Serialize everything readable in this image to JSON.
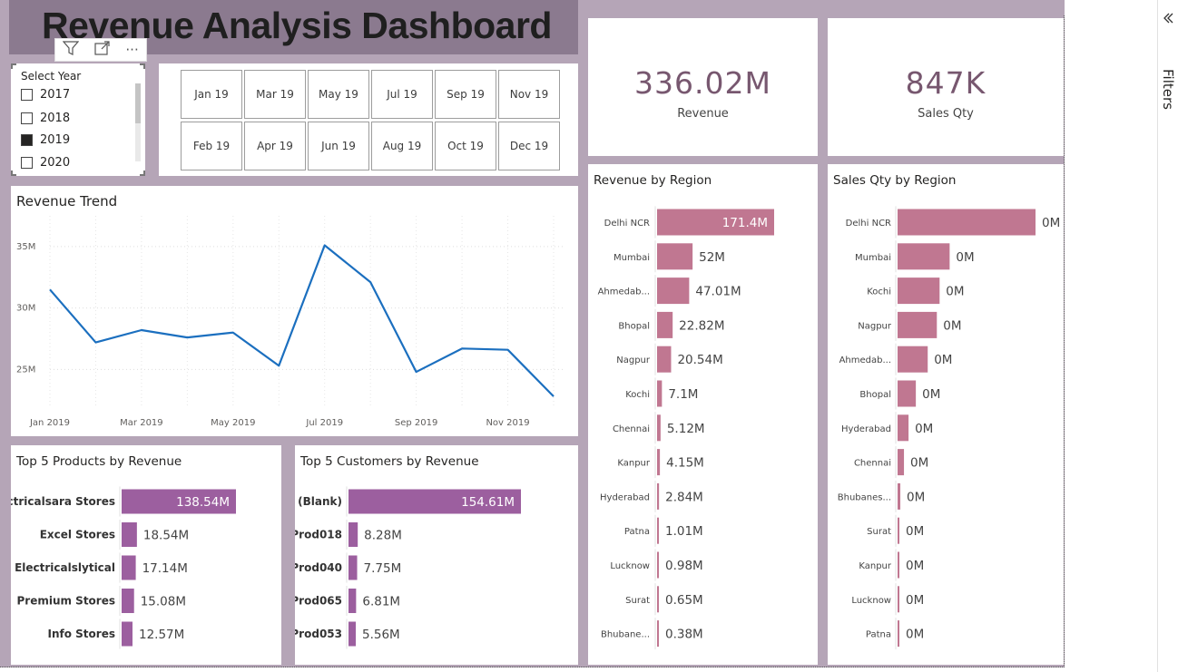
{
  "title": "Revenue Analysis Dashboard",
  "visual_toolbar": {
    "filter_icon": "filter-icon",
    "focus_icon": "focus-mode-icon",
    "more_icon": "more-options-icon",
    "more_label": "···"
  },
  "year_slicer": {
    "header": "Select Year",
    "options": [
      {
        "label": "2017",
        "checked": false
      },
      {
        "label": "2018",
        "checked": false
      },
      {
        "label": "2019",
        "checked": true
      },
      {
        "label": "2020",
        "checked": false
      }
    ]
  },
  "month_slicer": {
    "months": [
      "Jan 19",
      "Mar 19",
      "May 19",
      "Jul 19",
      "Sep 19",
      "Nov 19",
      "Feb 19",
      "Apr 19",
      "Jun 19",
      "Aug 19",
      "Oct 19",
      "Dec 19"
    ]
  },
  "kpis": [
    {
      "value": "336.02M",
      "label": "Revenue"
    },
    {
      "value": "847K",
      "label": "Sales Qty"
    }
  ],
  "filters_pane": {
    "label": "Filters",
    "collapse_icon": "chevron-left-icon"
  },
  "colors": {
    "bar": "#c07791",
    "purple_bar": "#9c5f9f",
    "line": "#1b6fbf",
    "background": "#b5a5b7",
    "title_bg": "#8b7a8f",
    "kpi": "#77576f"
  },
  "chart_data": [
    {
      "type": "line",
      "title": "Revenue Trend",
      "x": [
        "2019-01",
        "2019-02",
        "2019-03",
        "2019-04",
        "2019-05",
        "2019-06",
        "2019-07",
        "2019-08",
        "2019-09",
        "2019-10",
        "2019-11",
        "2019-12"
      ],
      "x_tick_labels": [
        "Jan 2019",
        "Mar 2019",
        "May 2019",
        "Jul 2019",
        "Sep 2019",
        "Nov 2019"
      ],
      "y": [
        31.5,
        27.2,
        28.2,
        27.6,
        28.0,
        25.3,
        35.1,
        32.1,
        24.8,
        26.7,
        26.6,
        22.8
      ],
      "y_tick_labels": [
        "35M",
        "30M",
        "25M"
      ],
      "y_ticks": [
        35,
        30,
        25
      ],
      "ylim": [
        22,
        37.5
      ],
      "grid": true
    },
    {
      "type": "bar",
      "orientation": "horizontal",
      "title": "Revenue by Region",
      "categories": [
        "Delhi NCR",
        "Mumbai",
        "Ahmedab...",
        "Bhopal",
        "Nagpur",
        "Kochi",
        "Chennai",
        "Kanpur",
        "Hyderabad",
        "Patna",
        "Lucknow",
        "Surat",
        "Bhubane..."
      ],
      "values": [
        171.4,
        52,
        47.01,
        22.82,
        20.54,
        7.1,
        5.12,
        4.15,
        2.84,
        1.01,
        0.98,
        0.65,
        0.38
      ],
      "labels": [
        "171.4M",
        "52M",
        "47.01M",
        "22.82M",
        "20.54M",
        "7.1M",
        "5.12M",
        "4.15M",
        "2.84M",
        "1.01M",
        "0.98M",
        "0.65M",
        "0.38M"
      ],
      "xlim": [
        0,
        171.4
      ]
    },
    {
      "type": "bar",
      "orientation": "horizontal",
      "title": "Sales Qty by Region",
      "categories": [
        "Delhi NCR",
        "Mumbai",
        "Kochi",
        "Nagpur",
        "Ahmedab...",
        "Bhopal",
        "Hyderabad",
        "Chennai",
        "Bhubanes...",
        "Surat",
        "Kanpur",
        "Lucknow",
        "Patna"
      ],
      "values": [
        151,
        57,
        46,
        43,
        33,
        20,
        12,
        7,
        3,
        2,
        2,
        1,
        0.5
      ],
      "labels": [
        "0M",
        "0M",
        "0M",
        "0M",
        "0M",
        "0M",
        "0M",
        "0M",
        "0M",
        "0M",
        "0M",
        "0M",
        "0M"
      ],
      "xlim": [
        0,
        151
      ]
    },
    {
      "type": "bar",
      "orientation": "horizontal",
      "title": "Top 5 Products by Revenue",
      "categories": [
        "Electricalsara Stores",
        "Excel Stores",
        "Electricalslytical",
        "Premium Stores",
        "Info Stores"
      ],
      "values": [
        138.54,
        18.54,
        17.14,
        15.08,
        12.57
      ],
      "labels": [
        "138.54M",
        "18.54M",
        "17.14M",
        "15.08M",
        "12.57M"
      ],
      "xlim": [
        0,
        138.54
      ]
    },
    {
      "type": "bar",
      "orientation": "horizontal",
      "title": "Top 5 Customers by Revenue",
      "categories": [
        "(Blank)",
        "Prod018",
        "Prod040",
        "Prod065",
        "Prod053"
      ],
      "values": [
        154.61,
        8.28,
        7.75,
        6.81,
        5.56
      ],
      "labels": [
        "154.61M",
        "8.28M",
        "7.75M",
        "6.81M",
        "5.56M"
      ],
      "xlim": [
        0,
        154.61
      ]
    }
  ]
}
